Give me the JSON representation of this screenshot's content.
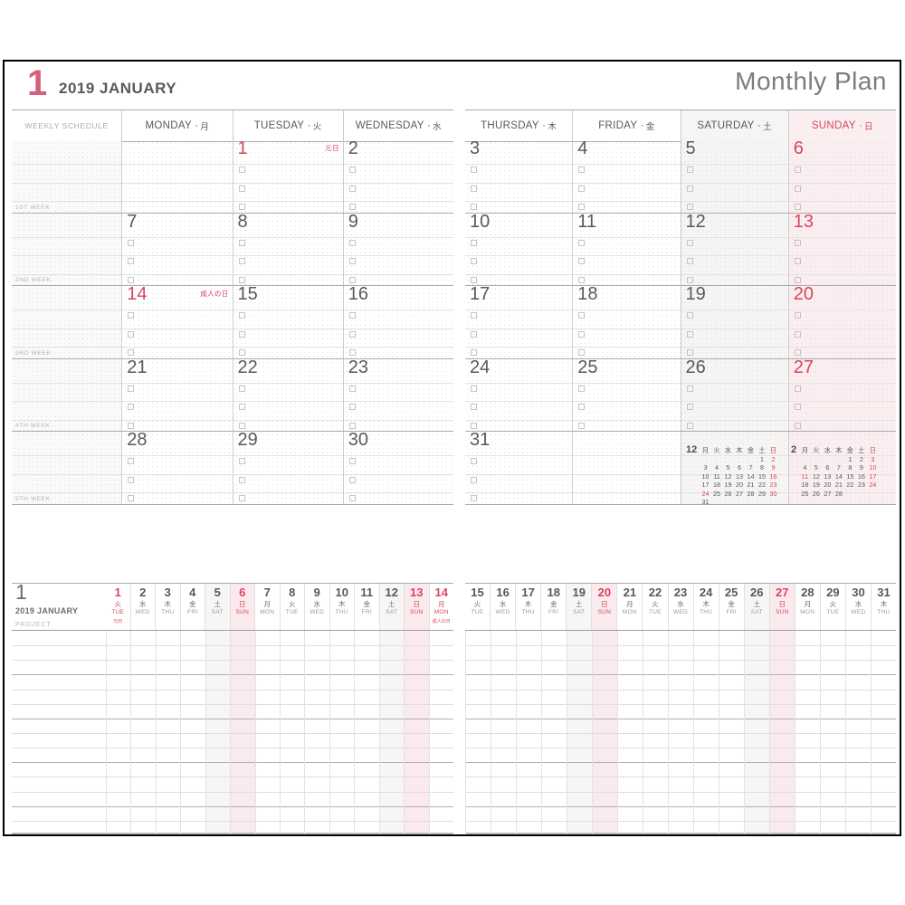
{
  "header": {
    "month_number": "1",
    "year_month": "2019  JANUARY",
    "plan_title": "Monthly Plan"
  },
  "weekly_schedule_label": "WEEKLY SCHEDULE",
  "day_headers": [
    {
      "en": "MONDAY",
      "cjk": "月",
      "type": "weekday"
    },
    {
      "en": "TUESDAY",
      "cjk": "火",
      "type": "weekday"
    },
    {
      "en": "WEDNESDAY",
      "cjk": "水",
      "type": "weekday"
    },
    {
      "en": "THURSDAY",
      "cjk": "木",
      "type": "weekday"
    },
    {
      "en": "FRIDAY",
      "cjk": "金",
      "type": "weekday"
    },
    {
      "en": "SATURDAY",
      "cjk": "土",
      "type": "saturday"
    },
    {
      "en": "SUNDAY",
      "cjk": "日",
      "type": "sunday"
    }
  ],
  "week_tags": [
    "1ST WEEK",
    "2ND WEEK",
    "3RD WEEK",
    "4TH WEEK",
    "5TH WEEK"
  ],
  "month_weeks": [
    {
      "tag": "1ST WEEK",
      "days": [
        {
          "n": "",
          "red": false,
          "holiday": ""
        },
        {
          "n": "1",
          "red": true,
          "holiday": "元日"
        },
        {
          "n": "2",
          "red": false,
          "holiday": ""
        },
        {
          "n": "3",
          "red": false,
          "holiday": ""
        },
        {
          "n": "4",
          "red": false,
          "holiday": ""
        },
        {
          "n": "5",
          "red": false,
          "holiday": ""
        },
        {
          "n": "6",
          "red": true,
          "holiday": ""
        }
      ]
    },
    {
      "tag": "2ND WEEK",
      "days": [
        {
          "n": "7",
          "red": false,
          "holiday": ""
        },
        {
          "n": "8",
          "red": false,
          "holiday": ""
        },
        {
          "n": "9",
          "red": false,
          "holiday": ""
        },
        {
          "n": "10",
          "red": false,
          "holiday": ""
        },
        {
          "n": "11",
          "red": false,
          "holiday": ""
        },
        {
          "n": "12",
          "red": false,
          "holiday": ""
        },
        {
          "n": "13",
          "red": true,
          "holiday": ""
        }
      ]
    },
    {
      "tag": "3RD WEEK",
      "days": [
        {
          "n": "14",
          "red": true,
          "holiday": "成人の日"
        },
        {
          "n": "15",
          "red": false,
          "holiday": ""
        },
        {
          "n": "16",
          "red": false,
          "holiday": ""
        },
        {
          "n": "17",
          "red": false,
          "holiday": ""
        },
        {
          "n": "18",
          "red": false,
          "holiday": ""
        },
        {
          "n": "19",
          "red": false,
          "holiday": ""
        },
        {
          "n": "20",
          "red": true,
          "holiday": ""
        }
      ]
    },
    {
      "tag": "4TH WEEK",
      "days": [
        {
          "n": "21",
          "red": false,
          "holiday": ""
        },
        {
          "n": "22",
          "red": false,
          "holiday": ""
        },
        {
          "n": "23",
          "red": false,
          "holiday": ""
        },
        {
          "n": "24",
          "red": false,
          "holiday": ""
        },
        {
          "n": "25",
          "red": false,
          "holiday": ""
        },
        {
          "n": "26",
          "red": false,
          "holiday": ""
        },
        {
          "n": "27",
          "red": true,
          "holiday": ""
        }
      ]
    },
    {
      "tag": "5TH WEEK",
      "days": [
        {
          "n": "28",
          "red": false,
          "holiday": ""
        },
        {
          "n": "29",
          "red": false,
          "holiday": ""
        },
        {
          "n": "30",
          "red": false,
          "holiday": ""
        },
        {
          "n": "31",
          "red": false,
          "holiday": ""
        },
        {
          "n": "",
          "red": false,
          "holiday": ""
        },
        {
          "n": "",
          "red": false,
          "holiday": ""
        },
        {
          "n": "",
          "red": false,
          "holiday": ""
        }
      ]
    }
  ],
  "mini_calendars": [
    {
      "label": "12",
      "weekday_heads": [
        "月",
        "火",
        "水",
        "木",
        "金",
        "土",
        "日"
      ],
      "rows": [
        [
          "",
          "",
          "",
          "",
          "",
          "1",
          "2"
        ],
        [
          "3",
          "4",
          "5",
          "6",
          "7",
          "8",
          "9"
        ],
        [
          "10",
          "11",
          "12",
          "13",
          "14",
          "15",
          "16"
        ],
        [
          "17",
          "18",
          "19",
          "20",
          "21",
          "22",
          "23"
        ],
        [
          "24",
          "25",
          "26",
          "27",
          "28",
          "29",
          "30"
        ],
        [
          "31",
          "",
          "",
          "",
          "",
          "",
          ""
        ]
      ],
      "red_days": [
        "2",
        "9",
        "16",
        "23",
        "24",
        "30"
      ]
    },
    {
      "label": "2",
      "weekday_heads": [
        "月",
        "火",
        "水",
        "木",
        "金",
        "土",
        "日"
      ],
      "rows": [
        [
          "",
          "",
          "",
          "",
          "1",
          "2",
          "3"
        ],
        [
          "4",
          "5",
          "6",
          "7",
          "8",
          "9",
          "10"
        ],
        [
          "11",
          "12",
          "13",
          "14",
          "15",
          "16",
          "17"
        ],
        [
          "18",
          "19",
          "20",
          "21",
          "22",
          "23",
          "24"
        ],
        [
          "25",
          "26",
          "27",
          "28",
          "",
          "",
          ""
        ]
      ],
      "red_days": [
        "3",
        "10",
        "11",
        "17",
        "24"
      ]
    }
  ],
  "project_panel": {
    "month_number": "1",
    "year_month": "2019  JANUARY",
    "project_label": "PROJECT",
    "left_days": [
      {
        "n": "1",
        "cjk": "火",
        "en": "TUE",
        "type": "holiday",
        "holiday": "元日"
      },
      {
        "n": "2",
        "cjk": "水",
        "en": "WED",
        "type": "weekday",
        "holiday": ""
      },
      {
        "n": "3",
        "cjk": "木",
        "en": "THU",
        "type": "weekday",
        "holiday": ""
      },
      {
        "n": "4",
        "cjk": "金",
        "en": "FRI",
        "type": "weekday",
        "holiday": ""
      },
      {
        "n": "5",
        "cjk": "土",
        "en": "SAT",
        "type": "saturday",
        "holiday": ""
      },
      {
        "n": "6",
        "cjk": "日",
        "en": "SUN",
        "type": "sunday",
        "holiday": ""
      },
      {
        "n": "7",
        "cjk": "月",
        "en": "MON",
        "type": "weekday",
        "holiday": ""
      },
      {
        "n": "8",
        "cjk": "火",
        "en": "TUE",
        "type": "weekday",
        "holiday": ""
      },
      {
        "n": "9",
        "cjk": "水",
        "en": "WED",
        "type": "weekday",
        "holiday": ""
      },
      {
        "n": "10",
        "cjk": "木",
        "en": "THU",
        "type": "weekday",
        "holiday": ""
      },
      {
        "n": "11",
        "cjk": "金",
        "en": "FRI",
        "type": "weekday",
        "holiday": ""
      },
      {
        "n": "12",
        "cjk": "土",
        "en": "SAT",
        "type": "saturday",
        "holiday": ""
      },
      {
        "n": "13",
        "cjk": "日",
        "en": "SUN",
        "type": "sunday",
        "holiday": ""
      },
      {
        "n": "14",
        "cjk": "月",
        "en": "MON",
        "type": "holiday",
        "holiday": "成人の日"
      }
    ],
    "right_days": [
      {
        "n": "15",
        "cjk": "火",
        "en": "TUE",
        "type": "weekday",
        "holiday": ""
      },
      {
        "n": "16",
        "cjk": "水",
        "en": "WED",
        "type": "weekday",
        "holiday": ""
      },
      {
        "n": "17",
        "cjk": "木",
        "en": "THU",
        "type": "weekday",
        "holiday": ""
      },
      {
        "n": "18",
        "cjk": "金",
        "en": "FRI",
        "type": "weekday",
        "holiday": ""
      },
      {
        "n": "19",
        "cjk": "土",
        "en": "SAT",
        "type": "saturday",
        "holiday": ""
      },
      {
        "n": "20",
        "cjk": "日",
        "en": "SUN",
        "type": "sunday",
        "holiday": ""
      },
      {
        "n": "21",
        "cjk": "月",
        "en": "MON",
        "type": "weekday",
        "holiday": ""
      },
      {
        "n": "22",
        "cjk": "火",
        "en": "TUE",
        "type": "weekday",
        "holiday": ""
      },
      {
        "n": "23",
        "cjk": "水",
        "en": "WED",
        "type": "weekday",
        "holiday": ""
      },
      {
        "n": "24",
        "cjk": "木",
        "en": "THU",
        "type": "weekday",
        "holiday": ""
      },
      {
        "n": "25",
        "cjk": "金",
        "en": "FRI",
        "type": "weekday",
        "holiday": ""
      },
      {
        "n": "26",
        "cjk": "土",
        "en": "SAT",
        "type": "saturday",
        "holiday": ""
      },
      {
        "n": "27",
        "cjk": "日",
        "en": "SUN",
        "type": "sunday",
        "holiday": ""
      },
      {
        "n": "28",
        "cjk": "月",
        "en": "MON",
        "type": "weekday",
        "holiday": ""
      },
      {
        "n": "29",
        "cjk": "火",
        "en": "TUE",
        "type": "weekday",
        "holiday": ""
      },
      {
        "n": "30",
        "cjk": "水",
        "en": "WED",
        "type": "weekday",
        "holiday": ""
      },
      {
        "n": "31",
        "cjk": "木",
        "en": "THU",
        "type": "weekday",
        "holiday": ""
      }
    ]
  },
  "colors": {
    "accent_red": "#d4475e",
    "month_num_red": "#d4607a",
    "ink": "#58595b",
    "sunday_bg": "#fbeef0",
    "saturday_bg": "#f7f5f4",
    "rule": "#a9abae"
  }
}
